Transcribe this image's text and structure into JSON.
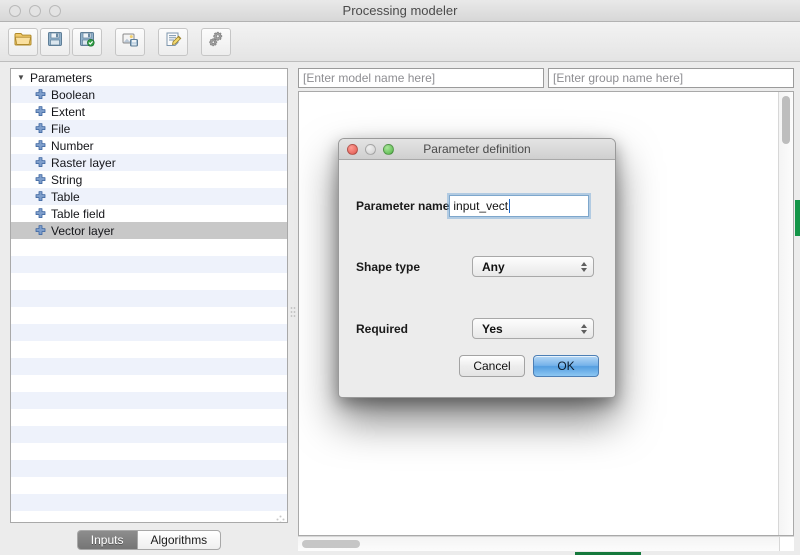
{
  "window": {
    "title": "Processing modeler",
    "traffic_lights": [
      "close-inactive",
      "minimize-inactive",
      "zoom-inactive"
    ]
  },
  "toolbar": {
    "buttons": [
      {
        "name": "open-model-button",
        "icon": "open-folder-icon"
      },
      {
        "name": "save-model-button",
        "icon": "floppy-save-icon"
      },
      {
        "name": "save-model-as-button",
        "icon": "floppy-save-as-icon"
      },
      {
        "name": "export-image-button",
        "icon": "export-image-icon"
      },
      {
        "name": "edit-help-button",
        "icon": "edit-note-icon"
      },
      {
        "name": "run-model-button",
        "icon": "gears-icon"
      }
    ]
  },
  "left_panel": {
    "tree": {
      "root_label": "Parameters",
      "root_expanded": true,
      "items": [
        "Boolean",
        "Extent",
        "File",
        "Number",
        "Raster layer",
        "String",
        "Table",
        "Table field",
        "Vector layer"
      ],
      "selected_item": "Vector layer",
      "empty_row_count": 17
    },
    "tabs": [
      {
        "label": "Inputs",
        "active": true
      },
      {
        "label": "Algorithms",
        "active": false
      }
    ]
  },
  "right_panel": {
    "model_name_field": {
      "value": "",
      "placeholder": "[Enter model name here]"
    },
    "group_name_field": {
      "value": "",
      "placeholder": "[Enter group name here]"
    },
    "canvas": {
      "content": ""
    }
  },
  "dialog": {
    "title": "Parameter definition",
    "traffic_lights": [
      "close-red",
      "minimize-gray",
      "zoom-green"
    ],
    "fields": {
      "parameter_name": {
        "label": "Parameter name",
        "value": "input_vect"
      },
      "shape_type": {
        "label": "Shape type",
        "value": "Any"
      },
      "required": {
        "label": "Required",
        "value": "Yes"
      }
    },
    "buttons": {
      "cancel": "Cancel",
      "ok": "OK"
    }
  },
  "colors": {
    "window_chrome": "#ececec",
    "tree_stripe": "#eef2fb",
    "tree_selection": "#c8c8c8",
    "default_button_blue": "#74b2ea",
    "focus_ring_blue": "#6ca4d8",
    "background_green": "#149548",
    "placeholder_gray": "#8e8e92"
  }
}
